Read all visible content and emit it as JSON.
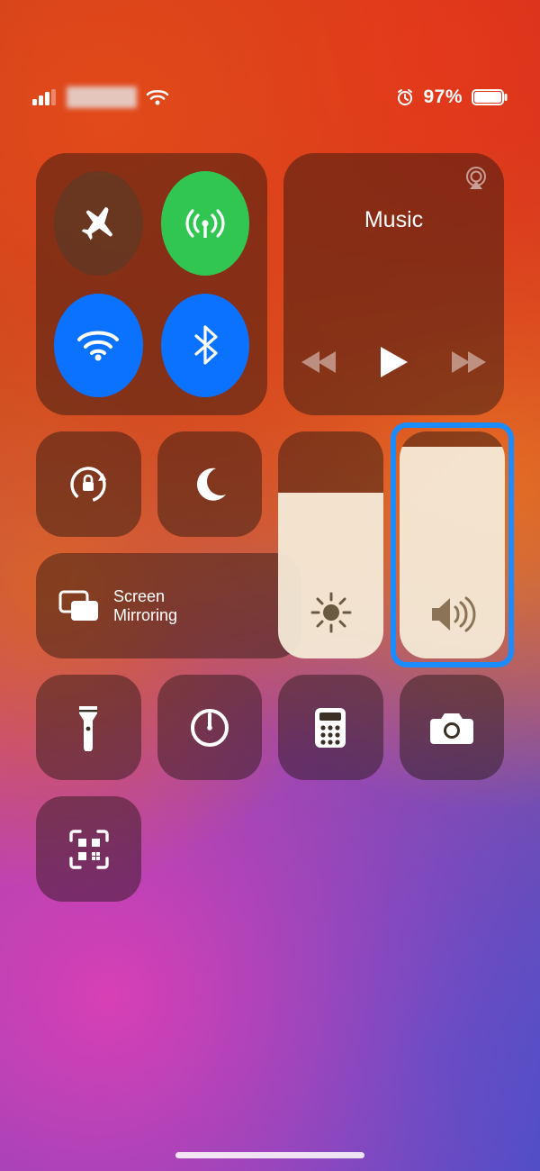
{
  "status": {
    "signal_bars": 4,
    "battery_percent_label": "97%",
    "alarm_set": true
  },
  "connectivity": {
    "airplane_active": false,
    "cellular_active": true,
    "wifi_active": true,
    "bluetooth_active": true
  },
  "music": {
    "title": "Music"
  },
  "screen_mirroring": {
    "label_line1": "Screen",
    "label_line2": "Mirroring"
  },
  "sliders": {
    "brightness_percent": 62,
    "volume_percent": 82,
    "volume_highlighted": true
  },
  "utility_buttons": [
    "flashlight",
    "timer",
    "calculator",
    "camera",
    "qr-code"
  ]
}
